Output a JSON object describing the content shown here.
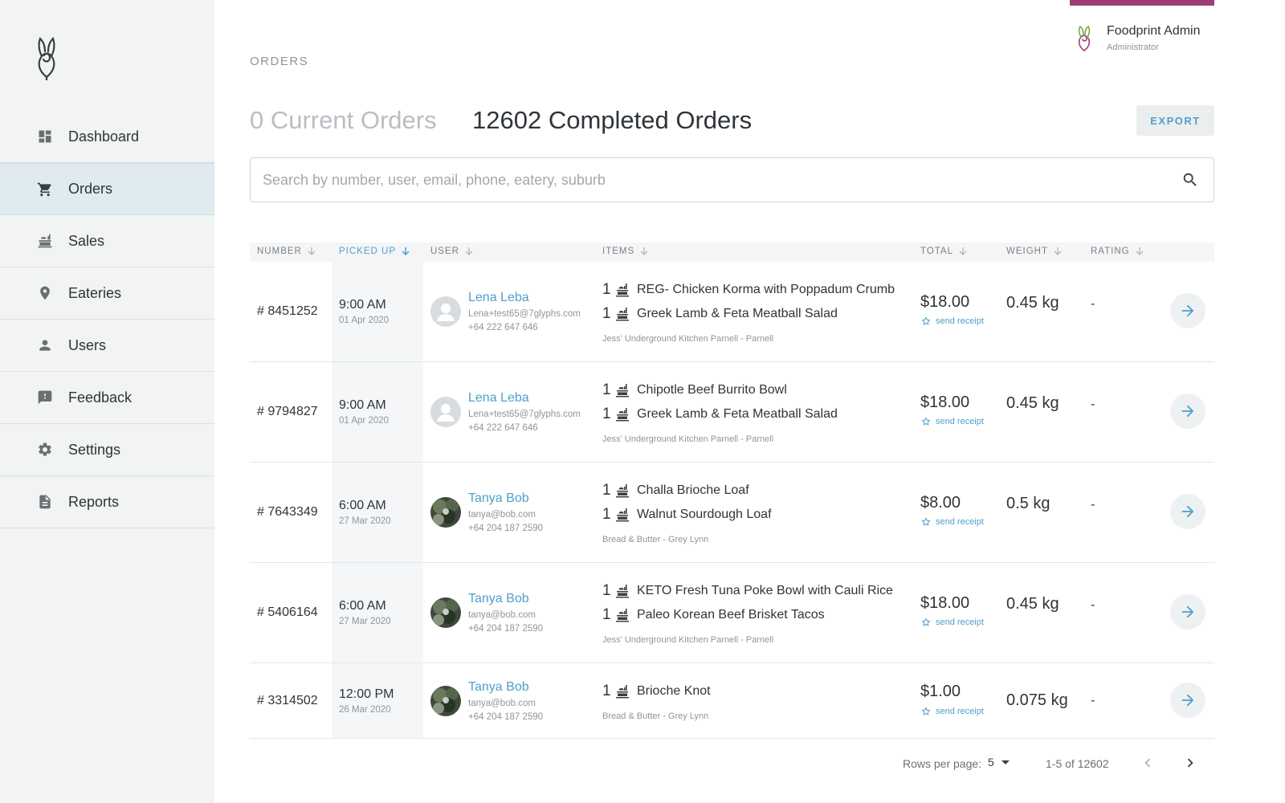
{
  "brand": {
    "accent": "#4f9fcc",
    "topbar_accent": "#9c3e74",
    "sidebar_bg": "#f2f3f3",
    "active_bg": "#dfeaf1"
  },
  "sidebar": {
    "logo_icon": "foodprint-logo",
    "items": [
      {
        "label": "Dashboard",
        "icon": "dashboard-icon",
        "active": false
      },
      {
        "label": "Orders",
        "icon": "cart-icon",
        "active": true
      },
      {
        "label": "Sales",
        "icon": "sales-icon",
        "active": false
      },
      {
        "label": "Eateries",
        "icon": "location-pin-icon",
        "active": false
      },
      {
        "label": "Users",
        "icon": "user-icon",
        "active": false
      },
      {
        "label": "Feedback",
        "icon": "feedback-icon",
        "active": false
      },
      {
        "label": "Settings",
        "icon": "gear-icon",
        "active": false
      },
      {
        "label": "Reports",
        "icon": "document-icon",
        "active": false
      }
    ]
  },
  "user": {
    "name": "Foodprint Admin",
    "role": "Administrator"
  },
  "page": {
    "breadcrumb": "ORDERS",
    "current_orders": "0 Current Orders",
    "completed_orders": "12602 Completed Orders",
    "export_label": "EXPORT"
  },
  "search": {
    "placeholder": "Search by number, user, email, phone, eatery, suburb",
    "value": ""
  },
  "table": {
    "columns": {
      "number": "NUMBER",
      "picked_up": "PICKED UP",
      "user": "USER",
      "items": "ITEMS",
      "total": "TOTAL",
      "weight": "WEIGHT",
      "rating": "RATING"
    },
    "rows": [
      {
        "number": "# 8451252",
        "time": "9:00 AM",
        "date": "01 Apr 2020",
        "user_name": "Lena Leba",
        "email": "Lena+test65@7glyphs.com",
        "phone": "+64 222 647 646",
        "avatar": "placeholder",
        "items": [
          {
            "qty": "1",
            "name": "REG- Chicken Korma with Poppadum Crumb"
          },
          {
            "qty": "1",
            "name": "Greek Lamb & Feta Meatball Salad"
          }
        ],
        "eatery": "Jess' Underground Kitchen Parnell - Parnell",
        "total": "$18.00",
        "receipt": "send receipt",
        "weight": "0.45 kg",
        "rating": "-"
      },
      {
        "number": "# 9794827",
        "time": "9:00 AM",
        "date": "01 Apr 2020",
        "user_name": "Lena Leba",
        "email": "Lena+test65@7glyphs.com",
        "phone": "+64 222 647 646",
        "avatar": "placeholder",
        "items": [
          {
            "qty": "1",
            "name": "Chipotle Beef Burrito Bowl"
          },
          {
            "qty": "1",
            "name": "Greek Lamb & Feta Meatball Salad"
          }
        ],
        "eatery": "Jess' Underground Kitchen Parnell - Parnell",
        "total": "$18.00",
        "receipt": "send receipt",
        "weight": "0.45 kg",
        "rating": "-"
      },
      {
        "number": "# 7643349",
        "time": "6:00 AM",
        "date": "27 Mar 2020",
        "user_name": "Tanya Bob",
        "email": "tanya@bob.com",
        "phone": "+64 204 187 2590",
        "avatar": "photo",
        "items": [
          {
            "qty": "1",
            "name": "Challa Brioche Loaf"
          },
          {
            "qty": "1",
            "name": "Walnut Sourdough Loaf"
          }
        ],
        "eatery": "Bread & Butter - Grey Lynn",
        "total": "$8.00",
        "receipt": "send receipt",
        "weight": "0.5 kg",
        "rating": "-"
      },
      {
        "number": "# 5406164",
        "time": "6:00 AM",
        "date": "27 Mar 2020",
        "user_name": "Tanya Bob",
        "email": "tanya@bob.com",
        "phone": "+64 204 187 2590",
        "avatar": "photo",
        "items": [
          {
            "qty": "1",
            "name": "KETO Fresh Tuna Poke Bowl with Cauli Rice"
          },
          {
            "qty": "1",
            "name": "Paleo Korean Beef Brisket Tacos"
          }
        ],
        "eatery": "Jess' Underground Kitchen Parnell - Parnell",
        "total": "$18.00",
        "receipt": "send receipt",
        "weight": "0.45 kg",
        "rating": "-"
      },
      {
        "number": "# 3314502",
        "time": "12:00 PM",
        "date": "26 Mar 2020",
        "user_name": "Tanya Bob",
        "email": "tanya@bob.com",
        "phone": "+64 204 187 2590",
        "avatar": "photo",
        "items": [
          {
            "qty": "1",
            "name": "Brioche Knot"
          }
        ],
        "eatery": "Bread & Butter - Grey Lynn",
        "total": "$1.00",
        "receipt": "send receipt",
        "weight": "0.075 kg",
        "rating": "-"
      }
    ]
  },
  "pagination": {
    "rows_per_page_label": "Rows per page:",
    "rows_per_page": "5",
    "range": "1-5 of 12602"
  }
}
